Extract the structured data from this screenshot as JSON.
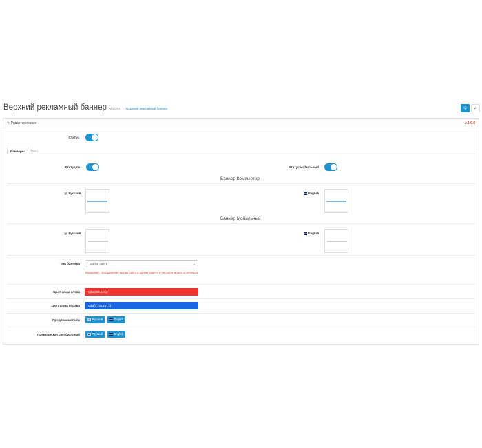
{
  "header": {
    "title": "Верхний рекламный баннер",
    "breadcrumb": [
      "Главная",
      "Модули",
      "Верхний рекламный баннер"
    ],
    "breadcrumb_sep": "›",
    "save_icon": "save-icon",
    "back_icon": "reply-icon",
    "save_glyph": "🖫",
    "back_glyph": "↶"
  },
  "panel": {
    "heading": "Редактирование",
    "heading_icon": "pencil-icon",
    "version": "v.1.0.0"
  },
  "status": {
    "label": "Статус",
    "enabled": true
  },
  "tabs": [
    {
      "label": "Баннеры",
      "active": true
    },
    {
      "label": "Текст",
      "active": false
    }
  ],
  "status_pc": {
    "label": "Статус пк",
    "enabled": true
  },
  "status_mobile": {
    "label": "Статус мобильный",
    "enabled": true
  },
  "banner_pc": {
    "title": "Баннер Компьютер",
    "langs": [
      "Русский",
      "English"
    ]
  },
  "banner_mobile": {
    "title": "Баннер Мобильный",
    "langs": [
      "Русский",
      "English"
    ]
  },
  "banner_type": {
    "label": "Тип баннера",
    "value": "Шапка сайта",
    "help": "Внимание: Отображение шапки сайта в одном помете и на сайте может отличаться"
  },
  "bg_left": {
    "label": "Цвет фона слева",
    "value": "rgba(255,0,0,1)",
    "color": "#ee3531"
  },
  "bg_right": {
    "label": "Цвет фона справа",
    "value": "rgba(0,101,241,1)",
    "color": "#1a66e0"
  },
  "preview_pc": {
    "label": "Предпросмотр пк",
    "buttons": [
      "Русский",
      "English"
    ]
  },
  "preview_mobile": {
    "label": "Предпросмотр мобильный",
    "buttons": [
      "Русский",
      "English"
    ]
  }
}
